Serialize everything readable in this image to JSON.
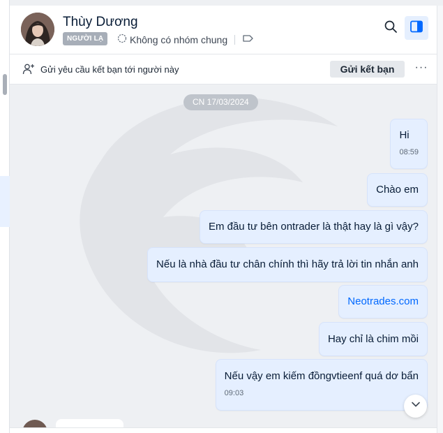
{
  "contact": {
    "name": "Thùy Dương",
    "badge": "NGƯỜI LẠ",
    "group_info": "Không có nhóm chung"
  },
  "header_icons": {
    "group": "group-circle-icon",
    "tag": "tag-icon",
    "search": "search-icon",
    "panel": "sidebar-toggle-icon"
  },
  "friend_request": {
    "text": "Gửi yêu cầu kết bạn tới người này",
    "button": "Gửi kết bạn",
    "more": "···"
  },
  "chat": {
    "date": "CN 17/03/2024",
    "messages": [
      {
        "text": "Hi",
        "time": "08:59"
      },
      {
        "text": "Chào em"
      },
      {
        "text": "Em đầu tư bên ontrader là thật hay là gì vậy?"
      },
      {
        "text": "Nếu là nhà đầu tư chân chính thì hãy trả lời tin nhắn anh"
      },
      {
        "text": "Neotrades.com",
        "is_link": true
      },
      {
        "text": "Hay chỉ là chim mồi"
      },
      {
        "text": "Nếu vậy em kiếm đồngvtieenf quá dơ bẩn",
        "time": "09:03"
      }
    ]
  },
  "colors": {
    "accent": "#0068ff",
    "own_bubble": "#e5efff",
    "badge": "#a7aeb8",
    "date_pill": "#bfc4cb"
  }
}
